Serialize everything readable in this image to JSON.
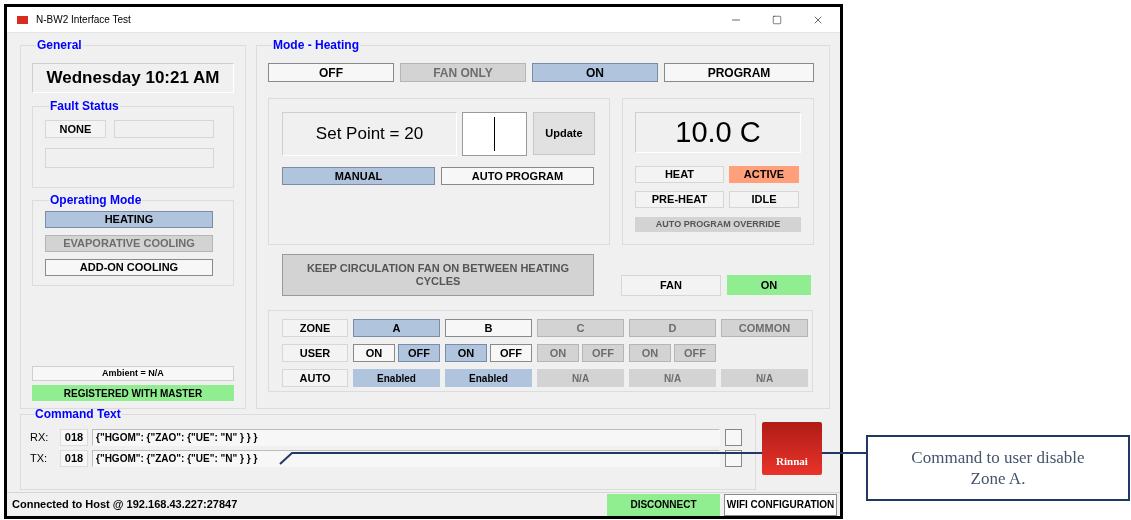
{
  "window": {
    "title": "N-BW2 Interface Test"
  },
  "general": {
    "title": "General",
    "datetime": "Wednesday 10:21 AM",
    "fault_status": {
      "title": "Fault Status",
      "code": "NONE"
    },
    "operating_mode": {
      "title": "Operating Mode",
      "options": [
        {
          "label": "HEATING",
          "selected": true,
          "disabled": false
        },
        {
          "label": "EVAPORATIVE COOLING",
          "selected": false,
          "disabled": true
        },
        {
          "label": "ADD-ON COOLING",
          "selected": false,
          "disabled": false
        }
      ]
    },
    "ambient": "Ambient = N/A",
    "registration": {
      "label": "REGISTERED WITH MASTER",
      "on": true
    }
  },
  "mode": {
    "title": "Mode - Heating",
    "modes": [
      {
        "label": "OFF",
        "selected": false,
        "disabled": false
      },
      {
        "label": "FAN ONLY",
        "selected": false,
        "disabled": true
      },
      {
        "label": "ON",
        "selected": true,
        "disabled": false
      },
      {
        "label": "PROGRAM",
        "selected": false,
        "disabled": false
      }
    ],
    "set_point": "Set Point = 20",
    "update_button": "Update",
    "control": [
      {
        "label": "MANUAL",
        "selected": true
      },
      {
        "label": "AUTO PROGRAM",
        "selected": false
      }
    ],
    "temperature": "10.0 C",
    "indicators": [
      {
        "label": "HEAT",
        "on": false
      },
      {
        "label": "ACTIVE",
        "on": true
      },
      {
        "label": "PRE-HEAT",
        "on": false
      },
      {
        "label": "IDLE",
        "on": false
      }
    ],
    "override": {
      "label": "AUTO PROGRAM OVERRIDE",
      "disabled": true
    },
    "circulation_button": {
      "label": "KEEP CIRCULATION FAN ON BETWEEN HEATING CYCLES",
      "disabled": true
    },
    "fan": {
      "label": "FAN",
      "value": "ON",
      "on": true
    },
    "zone_row_labels": [
      "ZONE",
      "USER",
      "AUTO"
    ],
    "zones": [
      {
        "name": "A",
        "selected": true,
        "disabled": false,
        "user": [
          {
            "label": "ON",
            "selected": false,
            "disabled": false
          },
          {
            "label": "OFF",
            "selected": true,
            "disabled": false
          }
        ],
        "auto": {
          "label": "Enabled",
          "selected": true,
          "disabled": false
        }
      },
      {
        "name": "B",
        "selected": false,
        "disabled": false,
        "user": [
          {
            "label": "ON",
            "selected": true,
            "disabled": false
          },
          {
            "label": "OFF",
            "selected": false,
            "disabled": false
          }
        ],
        "auto": {
          "label": "Enabled",
          "selected": true,
          "disabled": false
        }
      },
      {
        "name": "C",
        "selected": false,
        "disabled": true,
        "user": [
          {
            "label": "ON",
            "selected": false,
            "disabled": true
          },
          {
            "label": "OFF",
            "selected": false,
            "disabled": true
          }
        ],
        "auto": {
          "label": "N/A",
          "selected": false,
          "disabled": true
        }
      },
      {
        "name": "D",
        "selected": false,
        "disabled": true,
        "user": [
          {
            "label": "ON",
            "selected": false,
            "disabled": true
          },
          {
            "label": "OFF",
            "selected": false,
            "disabled": true
          }
        ],
        "auto": {
          "label": "N/A",
          "selected": false,
          "disabled": true
        }
      },
      {
        "name": "COMMON",
        "selected": false,
        "disabled": true,
        "auto": {
          "label": "N/A",
          "selected": false,
          "disabled": true
        }
      }
    ]
  },
  "command_text": {
    "title": "Command Text",
    "rows": [
      {
        "label": "RX:",
        "count": "018",
        "text": "{\"HGOM\": {\"ZAO\": {\"UE\": \"N\" } } }",
        "checked": false
      },
      {
        "label": "TX:",
        "count": "018",
        "text": "{\"HGOM\": {\"ZAO\": {\"UE\": \"N\" } } }",
        "checked": false
      }
    ]
  },
  "logo": "Rinnai",
  "status_bar": {
    "text": "Connected to Host @ 192.168.43.227:27847",
    "buttons": [
      {
        "label": "DISCONNECT",
        "on": true
      },
      {
        "label": "WIFI CONFIGURATION",
        "on": false
      }
    ]
  },
  "callout": "Command to user disable Zone A."
}
